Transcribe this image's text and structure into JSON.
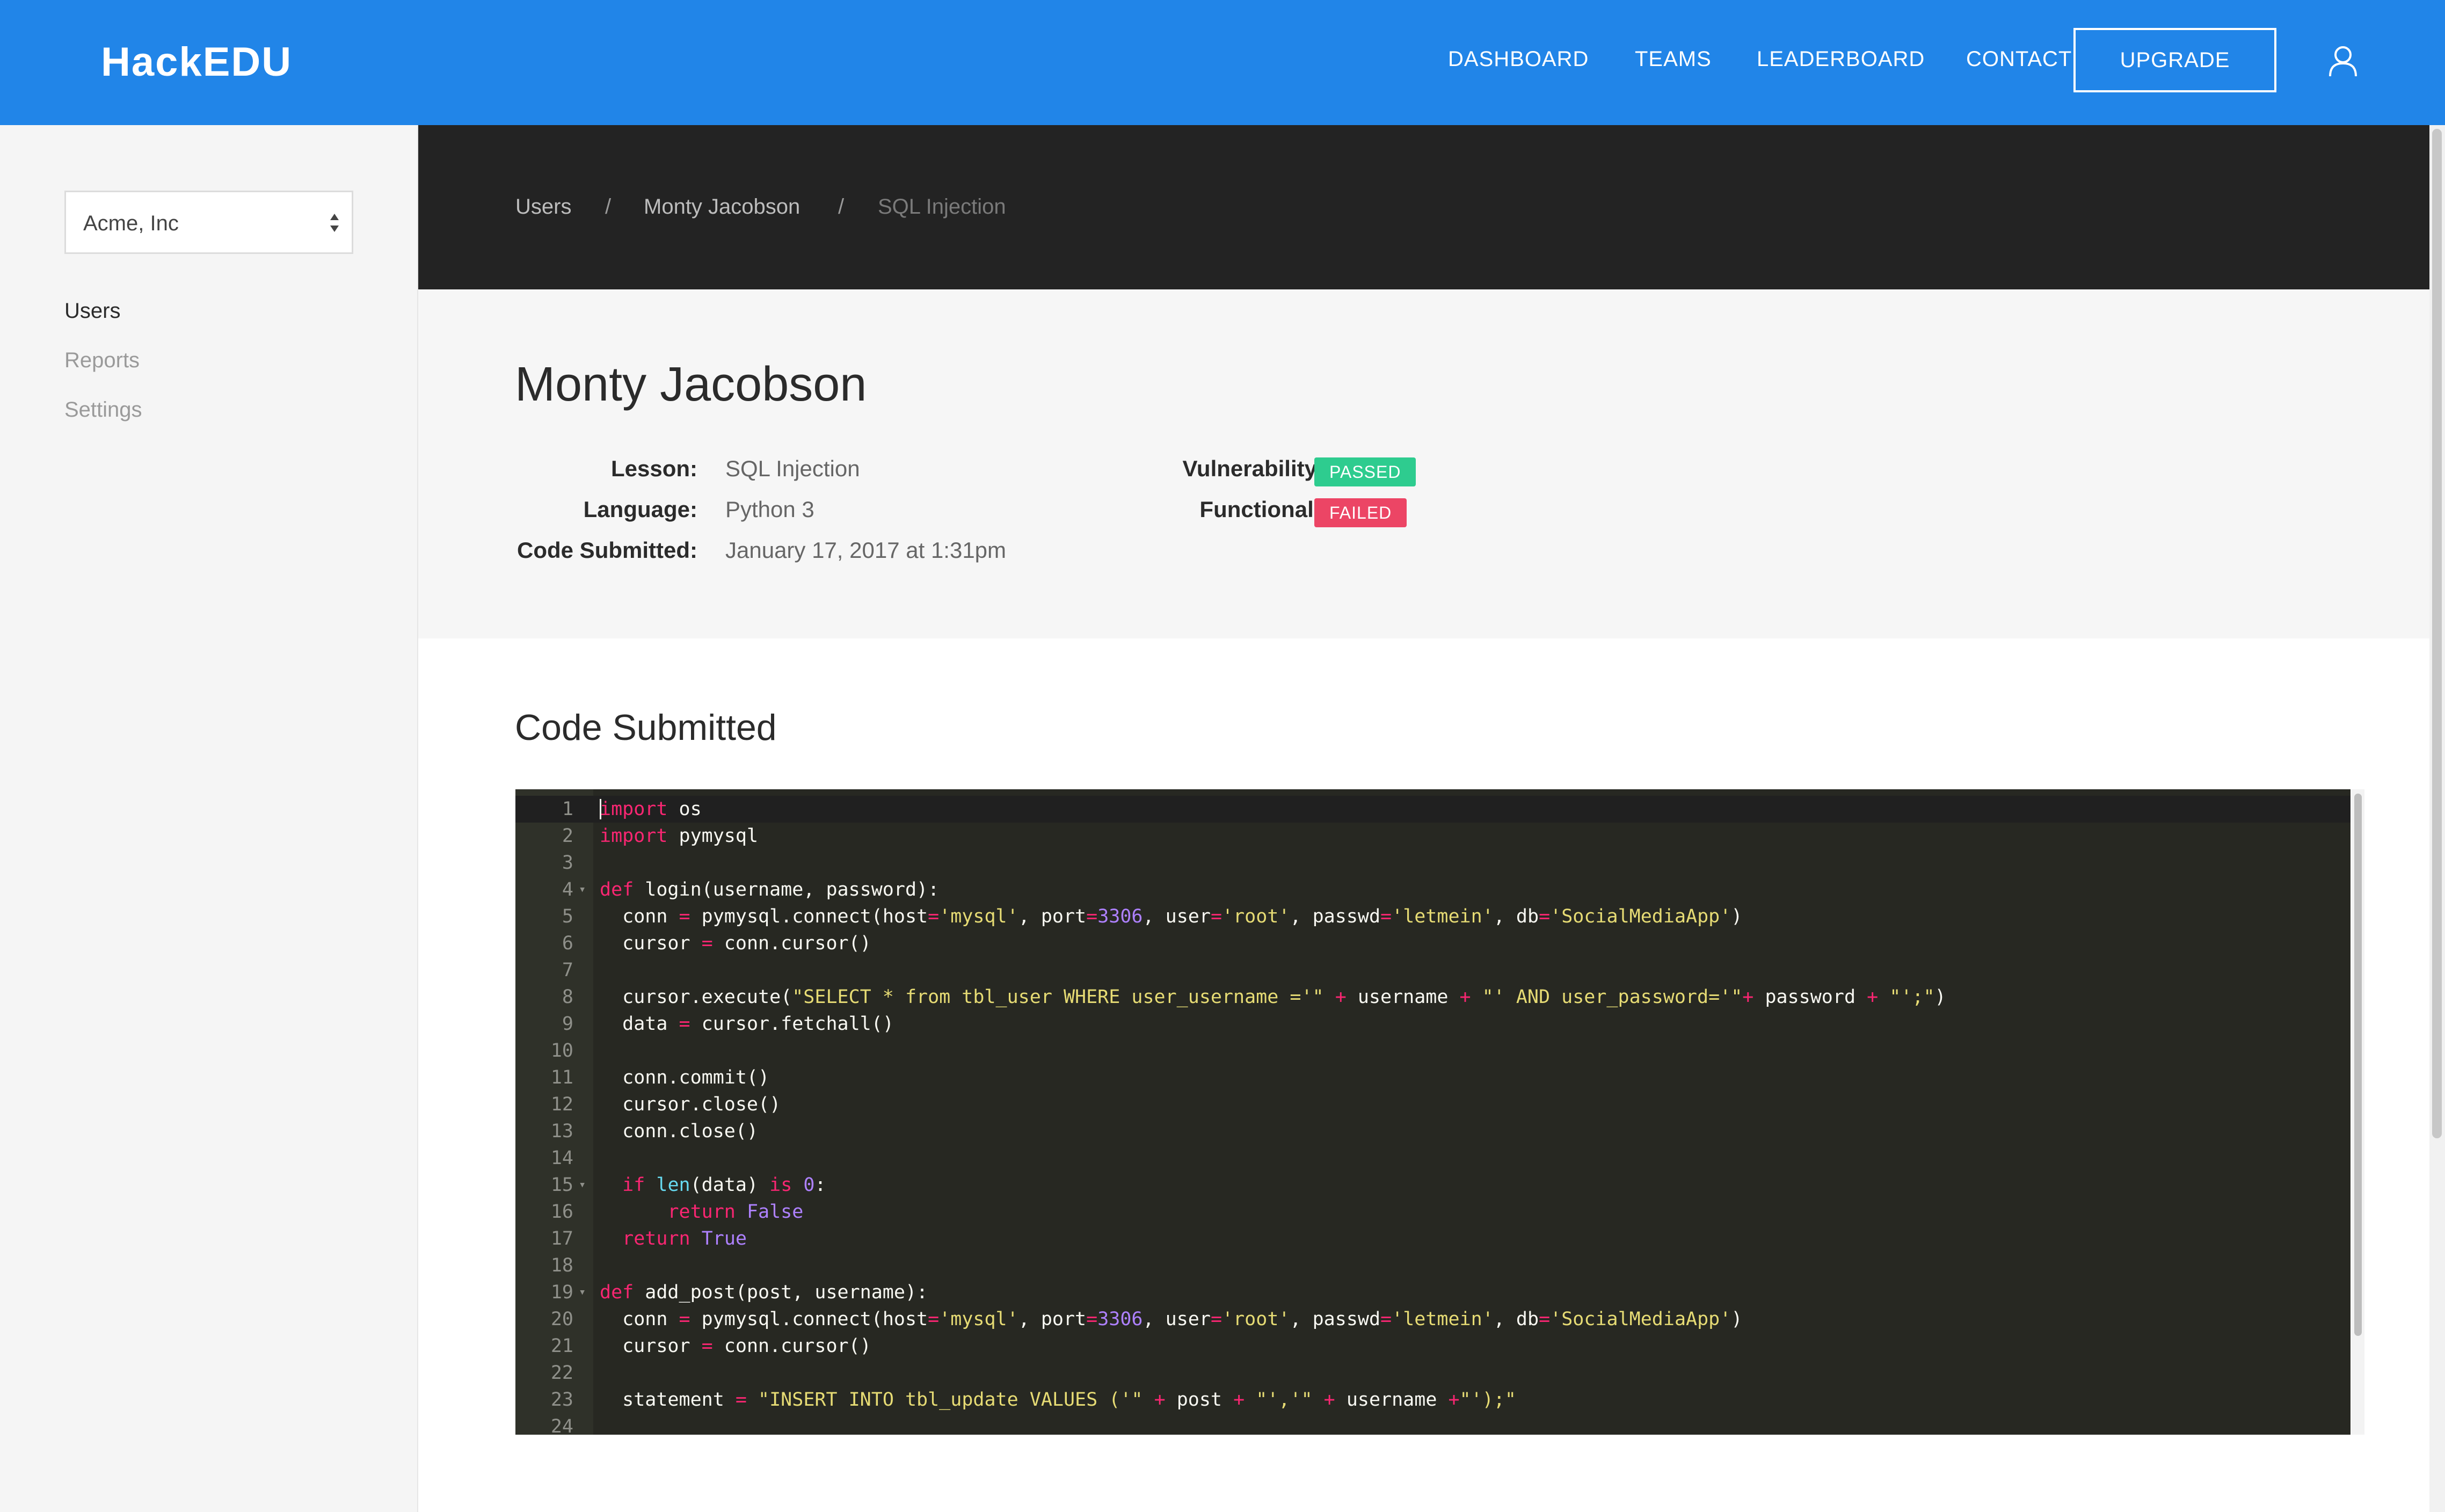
{
  "header": {
    "logo": "HackEDU",
    "nav": [
      "DASHBOARD",
      "TEAMS",
      "LEADERBOARD",
      "CONTACT"
    ],
    "upgrade_label": "UPGRADE",
    "icons": {
      "account": "user-icon"
    },
    "colors": {
      "brand": "#2185e8"
    }
  },
  "sidebar": {
    "organization_select": {
      "selected": "Acme, Inc",
      "icon": "select-arrows-icon"
    },
    "items": [
      {
        "label": "Users",
        "active": true
      },
      {
        "label": "Reports",
        "active": false
      },
      {
        "label": "Settings",
        "active": false
      }
    ]
  },
  "breadcrumb": {
    "items": [
      "Users",
      "Monty Jacobson",
      "SQL Injection"
    ],
    "separator": "/"
  },
  "submission": {
    "title": "Monty Jacobson",
    "fields": [
      {
        "label": "Lesson:",
        "value": "SQL Injection"
      },
      {
        "label": "Language:",
        "value": "Python 3"
      },
      {
        "label": "Code Submitted:",
        "value": "January 17, 2017 at 1:31pm"
      }
    ],
    "checks": [
      {
        "label": "Vulnerability Scan:",
        "status": "PASSED",
        "color": "#2ecc8f"
      },
      {
        "label": "Functional Tests:",
        "status": "FAILED",
        "color": "#ec4565"
      }
    ]
  },
  "code_section": {
    "title": "Code Submitted",
    "colors": {
      "keyword": "#f92672",
      "string": "#e6db74",
      "number": "#ae81ff",
      "builtin": "#66d9ef",
      "text": "#f8f8f2"
    },
    "lines": [
      {
        "n": "1",
        "fold": "",
        "tokens": [
          [
            "kw",
            "import"
          ],
          [
            "tx",
            " os"
          ]
        ]
      },
      {
        "n": "2",
        "fold": "",
        "tokens": [
          [
            "kw",
            "import"
          ],
          [
            "tx",
            " pymysql"
          ]
        ]
      },
      {
        "n": "3",
        "fold": "",
        "tokens": []
      },
      {
        "n": "4",
        "fold": "▾",
        "tokens": [
          [
            "kw",
            "def"
          ],
          [
            "tx",
            " login(username, password):"
          ]
        ]
      },
      {
        "n": "5",
        "fold": "",
        "tokens": [
          [
            "tx",
            "  conn "
          ],
          [
            "kw",
            "="
          ],
          [
            "tx",
            " pymysql.connect(host"
          ],
          [
            "kw",
            "="
          ],
          [
            "st",
            "'mysql'"
          ],
          [
            "tx",
            ", port"
          ],
          [
            "kw",
            "="
          ],
          [
            "nu",
            "3306"
          ],
          [
            "tx",
            ", user"
          ],
          [
            "kw",
            "="
          ],
          [
            "st",
            "'root'"
          ],
          [
            "tx",
            ", passwd"
          ],
          [
            "kw",
            "="
          ],
          [
            "st",
            "'letmein'"
          ],
          [
            "tx",
            ", db"
          ],
          [
            "kw",
            "="
          ],
          [
            "st",
            "'SocialMediaApp'"
          ],
          [
            "tx",
            ")"
          ]
        ]
      },
      {
        "n": "6",
        "fold": "",
        "tokens": [
          [
            "tx",
            "  cursor "
          ],
          [
            "kw",
            "="
          ],
          [
            "tx",
            " conn.cursor()"
          ]
        ]
      },
      {
        "n": "7",
        "fold": "",
        "tokens": []
      },
      {
        "n": "8",
        "fold": "",
        "tokens": [
          [
            "tx",
            "  cursor.execute("
          ],
          [
            "st",
            "\"SELECT * from tbl_user WHERE user_username ='\""
          ],
          [
            "tx",
            " "
          ],
          [
            "kw",
            "+"
          ],
          [
            "tx",
            " username "
          ],
          [
            "kw",
            "+"
          ],
          [
            "tx",
            " "
          ],
          [
            "st",
            "\"' AND user_password='\""
          ],
          [
            "kw",
            "+"
          ],
          [
            "tx",
            " password "
          ],
          [
            "kw",
            "+"
          ],
          [
            "tx",
            " "
          ],
          [
            "st",
            "\"';\""
          ],
          [
            "tx",
            ")"
          ]
        ]
      },
      {
        "n": "9",
        "fold": "",
        "tokens": [
          [
            "tx",
            "  data "
          ],
          [
            "kw",
            "="
          ],
          [
            "tx",
            " cursor.fetchall()"
          ]
        ]
      },
      {
        "n": "10",
        "fold": "",
        "tokens": []
      },
      {
        "n": "11",
        "fold": "",
        "tokens": [
          [
            "tx",
            "  conn.commit()"
          ]
        ]
      },
      {
        "n": "12",
        "fold": "",
        "tokens": [
          [
            "tx",
            "  cursor.close()"
          ]
        ]
      },
      {
        "n": "13",
        "fold": "",
        "tokens": [
          [
            "tx",
            "  conn.close()"
          ]
        ]
      },
      {
        "n": "14",
        "fold": "",
        "tokens": []
      },
      {
        "n": "15",
        "fold": "▾",
        "tokens": [
          [
            "tx",
            "  "
          ],
          [
            "kw",
            "if"
          ],
          [
            "tx",
            " "
          ],
          [
            "bi",
            "len"
          ],
          [
            "tx",
            "(data) "
          ],
          [
            "kw",
            "is"
          ],
          [
            "tx",
            " "
          ],
          [
            "nu",
            "0"
          ],
          [
            "tx",
            ":"
          ]
        ]
      },
      {
        "n": "16",
        "fold": "",
        "tokens": [
          [
            "tx",
            "      "
          ],
          [
            "kw",
            "return"
          ],
          [
            "tx",
            " "
          ],
          [
            "nu",
            "False"
          ]
        ]
      },
      {
        "n": "17",
        "fold": "",
        "tokens": [
          [
            "tx",
            "  "
          ],
          [
            "kw",
            "return"
          ],
          [
            "tx",
            " "
          ],
          [
            "nu",
            "True"
          ]
        ]
      },
      {
        "n": "18",
        "fold": "",
        "tokens": []
      },
      {
        "n": "19",
        "fold": "▾",
        "tokens": [
          [
            "kw",
            "def"
          ],
          [
            "tx",
            " add_post(post, username):"
          ]
        ]
      },
      {
        "n": "20",
        "fold": "",
        "tokens": [
          [
            "tx",
            "  conn "
          ],
          [
            "kw",
            "="
          ],
          [
            "tx",
            " pymysql.connect(host"
          ],
          [
            "kw",
            "="
          ],
          [
            "st",
            "'mysql'"
          ],
          [
            "tx",
            ", port"
          ],
          [
            "kw",
            "="
          ],
          [
            "nu",
            "3306"
          ],
          [
            "tx",
            ", user"
          ],
          [
            "kw",
            "="
          ],
          [
            "st",
            "'root'"
          ],
          [
            "tx",
            ", passwd"
          ],
          [
            "kw",
            "="
          ],
          [
            "st",
            "'letmein'"
          ],
          [
            "tx",
            ", db"
          ],
          [
            "kw",
            "="
          ],
          [
            "st",
            "'SocialMediaApp'"
          ],
          [
            "tx",
            ")"
          ]
        ]
      },
      {
        "n": "21",
        "fold": "",
        "tokens": [
          [
            "tx",
            "  cursor "
          ],
          [
            "kw",
            "="
          ],
          [
            "tx",
            " conn.cursor()"
          ]
        ]
      },
      {
        "n": "22",
        "fold": "",
        "tokens": []
      },
      {
        "n": "23",
        "fold": "",
        "tokens": [
          [
            "tx",
            "  statement "
          ],
          [
            "kw",
            "="
          ],
          [
            "tx",
            " "
          ],
          [
            "st",
            "\"INSERT INTO tbl_update VALUES ('\""
          ],
          [
            "tx",
            " "
          ],
          [
            "kw",
            "+"
          ],
          [
            "tx",
            " post "
          ],
          [
            "kw",
            "+"
          ],
          [
            "tx",
            " "
          ],
          [
            "st",
            "\"','\""
          ],
          [
            "tx",
            " "
          ],
          [
            "kw",
            "+"
          ],
          [
            "tx",
            " username "
          ],
          [
            "kw",
            "+"
          ],
          [
            "st",
            "\"');\""
          ]
        ]
      },
      {
        "n": "24",
        "fold": "",
        "tokens": []
      }
    ]
  }
}
